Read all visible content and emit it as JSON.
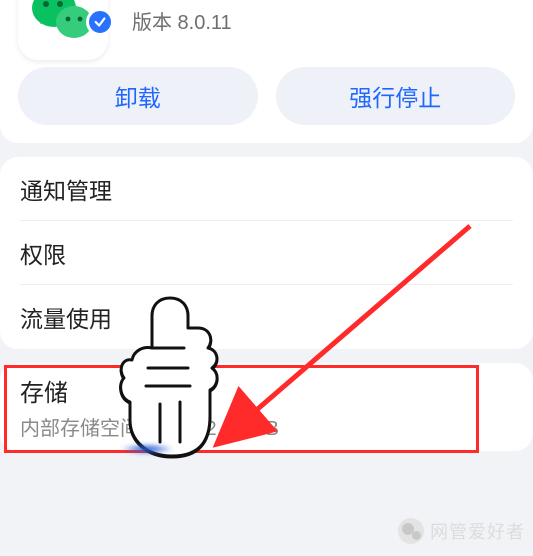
{
  "app": {
    "version_label": "版本 8.0.11"
  },
  "buttons": {
    "uninstall": "卸载",
    "force_stop": "强行停止"
  },
  "settings": {
    "rows": [
      {
        "label": "通知管理"
      },
      {
        "label": "权限"
      },
      {
        "label": "流量使用"
      }
    ]
  },
  "storage": {
    "title": "存储",
    "subtitle": "内部存储空间已使用 2.67 GB"
  },
  "watermark": {
    "text": "网管爱好者"
  }
}
